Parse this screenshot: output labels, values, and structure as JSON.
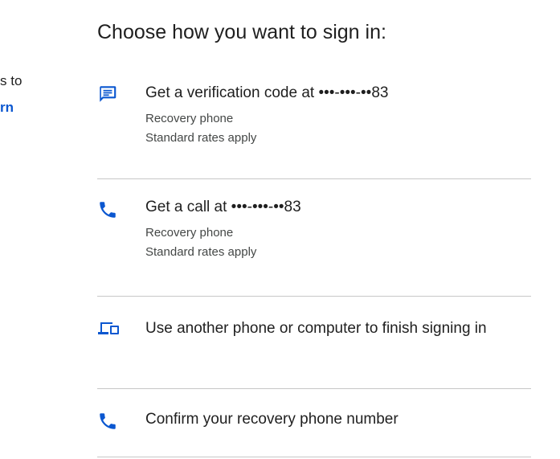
{
  "left_panel": {
    "text_fragment": "s to",
    "link_fragment": "rn"
  },
  "title": "Choose how you want to sign in:",
  "options": [
    {
      "icon": "message-icon",
      "label": "Get a verification code at •••-•••-••83",
      "sub1": "Recovery phone",
      "sub2": "Standard rates apply"
    },
    {
      "icon": "phone-icon",
      "label": "Get a call at •••-•••-••83",
      "sub1": "Recovery phone",
      "sub2": "Standard rates apply"
    },
    {
      "icon": "devices-icon",
      "label": "Use another phone or computer to finish signing in"
    },
    {
      "icon": "phone-icon",
      "label": "Confirm your recovery phone number"
    }
  ],
  "colors": {
    "accent": "#0b57d0",
    "text": "#1f1f1f",
    "secondary_text": "#444746",
    "divider": "#c7c7c7"
  }
}
